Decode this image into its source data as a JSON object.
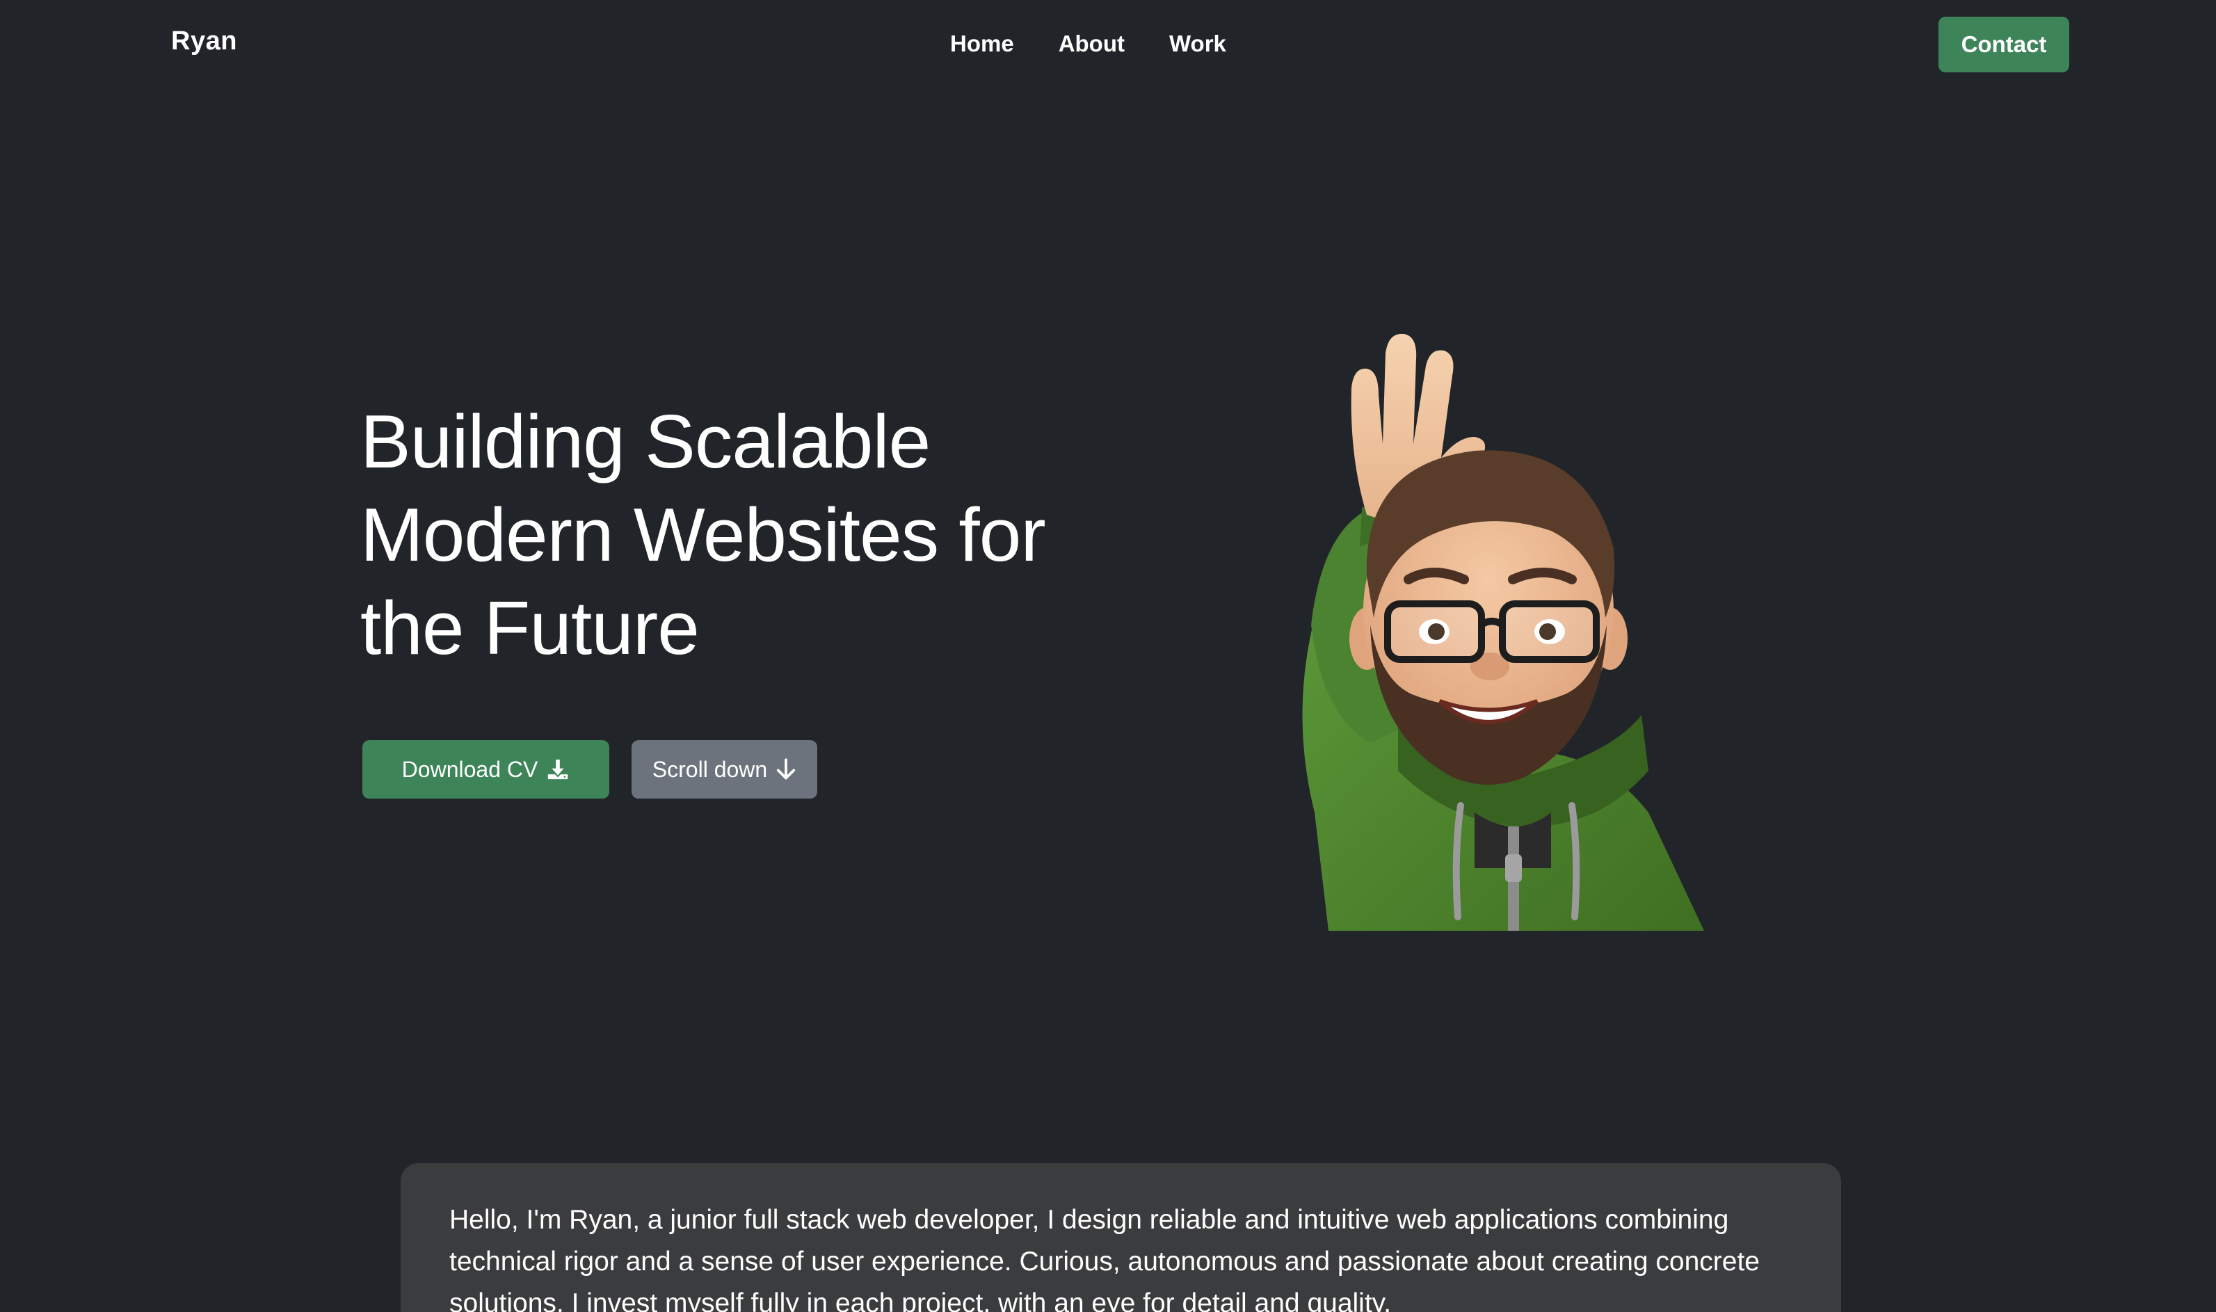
{
  "navbar": {
    "brand": "Ryan",
    "links": [
      {
        "label": "Home"
      },
      {
        "label": "About"
      },
      {
        "label": "Work"
      }
    ],
    "contact_label": "Contact"
  },
  "hero": {
    "title_lines": [
      "Building Scalable",
      "Modern Websites for",
      "the Future"
    ],
    "download_cv_label": "Download CV",
    "download_cv_icon": "download-icon",
    "scroll_down_label": "Scroll down",
    "scroll_down_icon": "arrow-down-icon",
    "avatar_icon": "waving-memoji-avatar"
  },
  "about": {
    "text": "Hello, I'm Ryan, a junior full stack web developer, I design reliable and intuitive web applications combining technical rigor and a sense of user experience. Curious, autonomous and passionate about creating concrete solutions, I invest myself fully in each project, with an eye for detail and quality."
  },
  "colors": {
    "background": "#212429",
    "accent_green": "#3d8559",
    "secondary_gray": "#6c737c",
    "card_background": "#3b3c3e",
    "text": "#ffffff"
  }
}
